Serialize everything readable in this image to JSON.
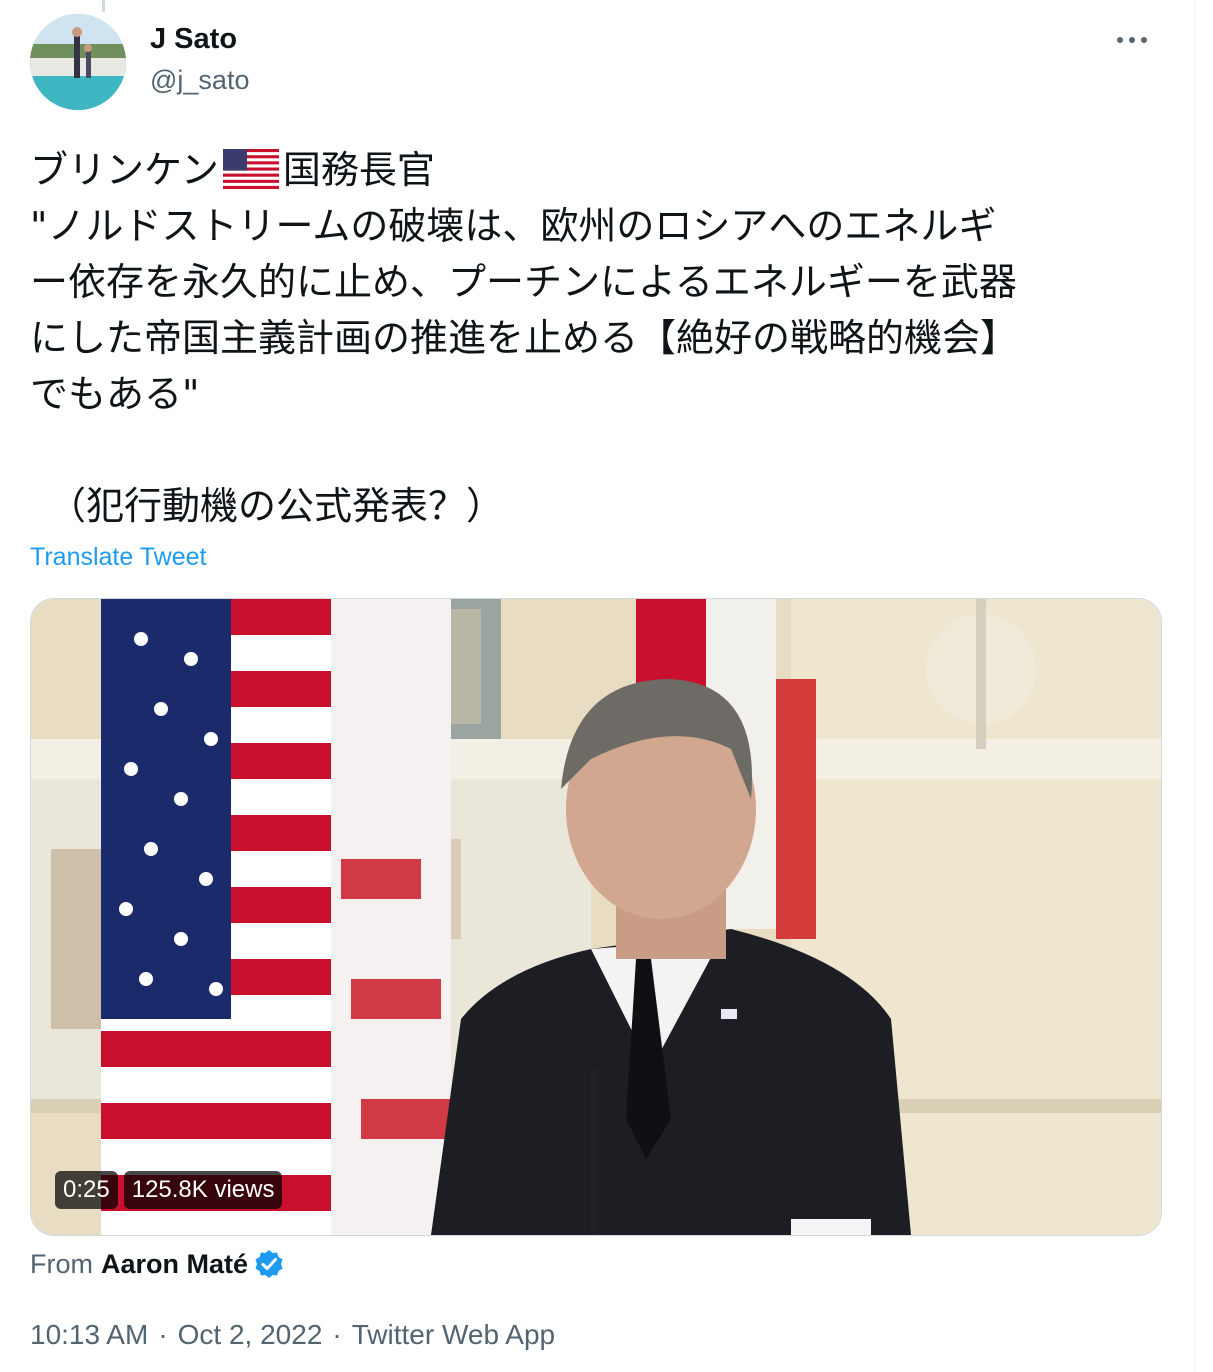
{
  "user": {
    "display_name": "J Sato",
    "handle": "@j_sato",
    "avatar_icon": "profile-avatar"
  },
  "header": {
    "more_icon": "more-horizontal-icon"
  },
  "tweet": {
    "line1_before_flag": "ブリンケン",
    "flag_icon": "us-flag-emoji",
    "line1_after_flag": "国務長官",
    "line2": "\"ノルドストリームの破壊は、欧州のロシアへのエネルギ",
    "line3": "ー依存を永久的に止め、プーチンによるエネルギーを武器",
    "line4": "にした帝国主義計画の推進を止める【絶好の戦略的機会】",
    "line5": "でもある\"",
    "line6": "（犯行動機の公式発表？）",
    "translate_label": "Translate Tweet"
  },
  "media": {
    "duration": "0:25",
    "views": "125.8K views",
    "thumbnail_icon": "video-thumbnail-press-conference"
  },
  "attribution": {
    "prefix": "From",
    "author": "Aaron Maté",
    "verified_icon": "verified-badge-icon"
  },
  "meta": {
    "time": "10:13 AM",
    "separator1": "·",
    "date": "Oct 2, 2022",
    "separator2": "·",
    "source": "Twitter Web App"
  },
  "colors": {
    "link_blue": "#1d9bf0",
    "secondary_text": "#536471",
    "primary_text": "#0f1419"
  }
}
